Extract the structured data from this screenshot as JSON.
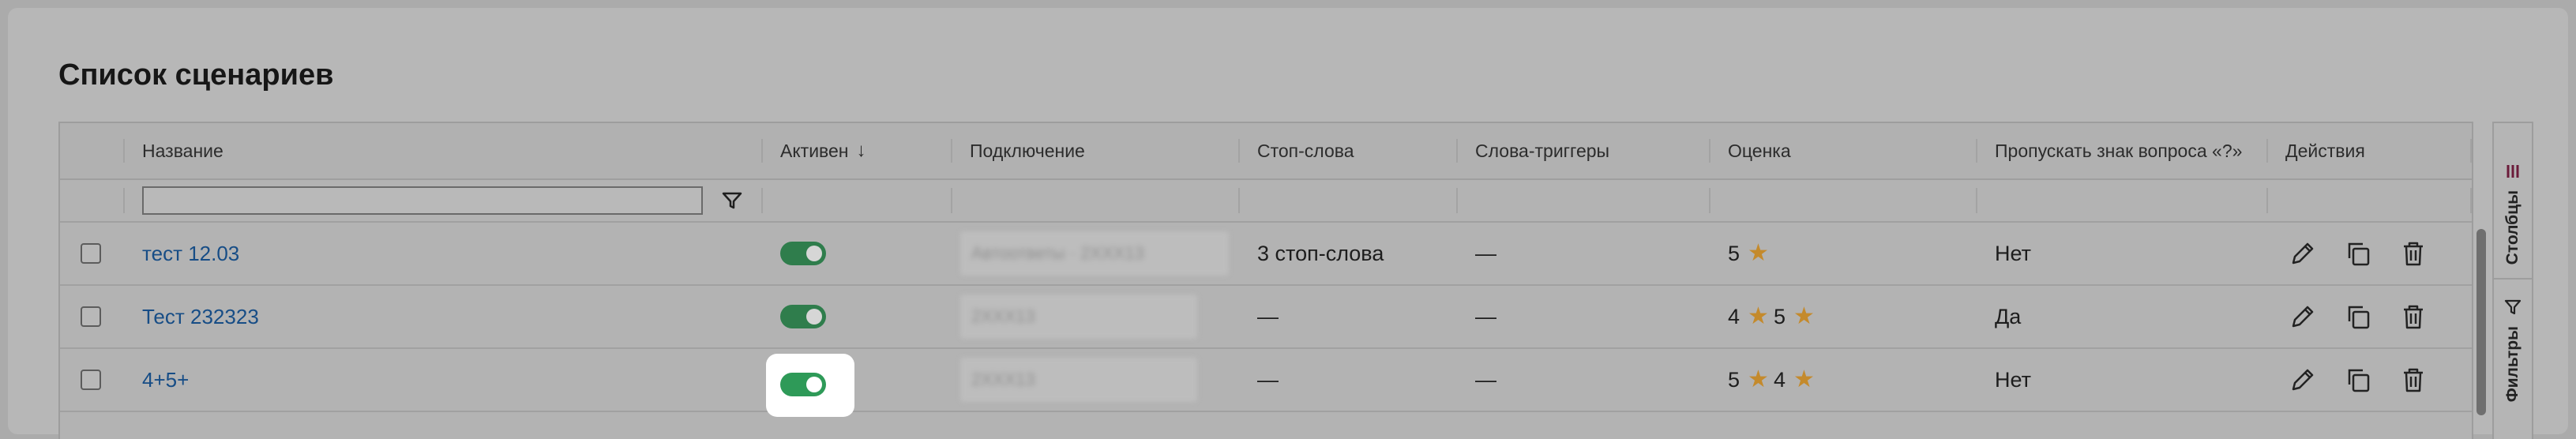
{
  "page": {
    "title": "Список сценариев"
  },
  "table": {
    "columns": [
      "Название",
      "Активен",
      "Подключение",
      "Стоп-слова",
      "Слова-триггеры",
      "Оценка",
      "Пропускать знак вопроса «?»",
      "Действия"
    ],
    "sort_indicator": "↓",
    "filter_value": "",
    "rows": [
      {
        "name": "тест 12.03",
        "active": true,
        "connection": "Автоответы · 2ХХХ13",
        "stop_words": "3 стоп-слова",
        "triggers": "—",
        "rating_a": "5",
        "rating_b": "",
        "skip_q": "Нет"
      },
      {
        "name": "Тест 232323",
        "active": true,
        "connection": "2ХХХ13",
        "stop_words": "—",
        "triggers": "—",
        "rating_a": "4",
        "rating_b": "5",
        "skip_q": "Да"
      },
      {
        "name": "4+5+",
        "active": true,
        "connection": "2ХХХ13",
        "stop_words": "—",
        "triggers": "—",
        "rating_a": "5",
        "rating_b": "4",
        "skip_q": "Нет"
      }
    ]
  },
  "side_rail": {
    "columns_label": "Столбцы",
    "filters_label": "Фильтры"
  },
  "icons": {
    "edit": "pencil-icon",
    "copy": "copy-icon",
    "delete": "trash-icon",
    "filter": "funnel-icon",
    "star": "star-icon",
    "columns": "columns-icon"
  },
  "colors": {
    "link": "#174d86",
    "toggle_on": "#2e9a58",
    "star": "#e0a43c",
    "overlay": "#ababab"
  }
}
